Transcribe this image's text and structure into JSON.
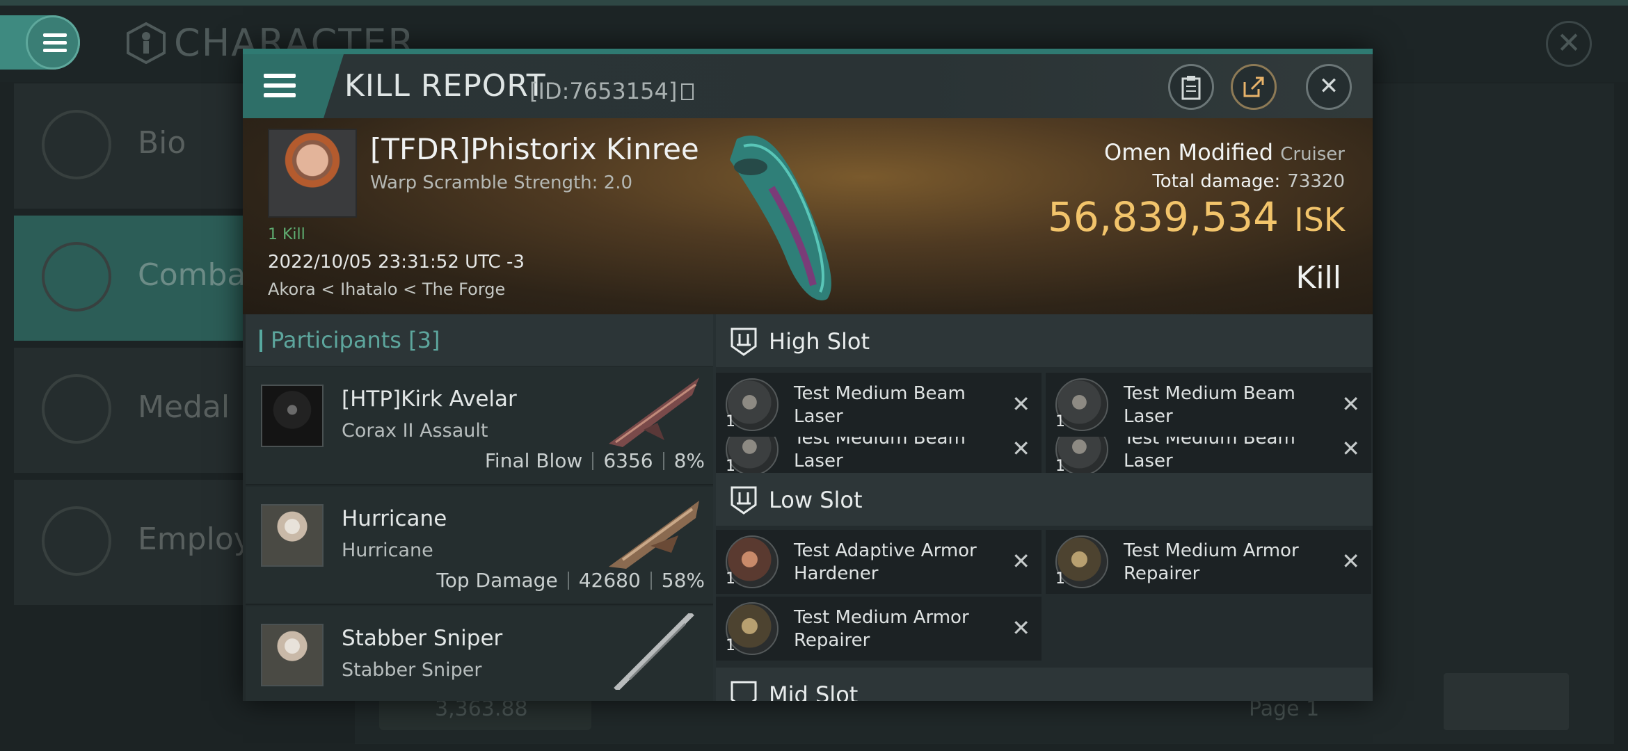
{
  "background": {
    "title": "CHARACTER",
    "sidebar": [
      {
        "label": "Bio",
        "icon": "list-icon"
      },
      {
        "label": "Combat",
        "icon": "crossed-swords-icon"
      },
      {
        "label": "Medal",
        "icon": "star-hexagon-icon"
      },
      {
        "label": "Employ",
        "icon": "star-circle-icon"
      }
    ],
    "amount": "3,363.88",
    "page": "Page 1"
  },
  "modal": {
    "title": "KILL REPORT",
    "id_label": "[ID:7653154]",
    "victim": {
      "name": "[TFDR]Phistorix Kinree",
      "warp_scramble": "Warp Scramble Strength: 2.0",
      "kills": "1 Kill",
      "time": "2022/10/05 23:31:52 UTC -3",
      "location": "Akora < Ihatalo < The Forge",
      "ship": "Omen Modified",
      "ship_class": "Cruiser",
      "total_damage_label": "Total damage:",
      "total_damage": "73320",
      "isk_value": "56,839,534",
      "isk_unit": "ISK",
      "result": "Kill"
    },
    "participants": {
      "heading": "Participants [3]",
      "rows": [
        {
          "name": "[HTP]Kirk Avelar",
          "ship": "Corax II Assault",
          "role": "Final Blow",
          "damage": "6356",
          "percent": "8%"
        },
        {
          "name": "Hurricane",
          "ship": "Hurricane",
          "role": "Top Damage",
          "damage": "42680",
          "percent": "58%"
        },
        {
          "name": "Stabber Sniper",
          "ship": "Stabber Sniper",
          "role": "",
          "damage": "",
          "percent": ""
        }
      ]
    },
    "fitting": {
      "high_slot": {
        "label": "High Slot",
        "modules": [
          {
            "name": "Test Medium Beam Laser",
            "qty": "1"
          },
          {
            "name": "Test Medium Beam Laser",
            "qty": "1"
          },
          {
            "name": "Test Medium Beam Laser",
            "qty": "1"
          },
          {
            "name": "Test Medium Beam Laser",
            "qty": "1"
          }
        ]
      },
      "low_slot": {
        "label": "Low Slot",
        "modules": [
          {
            "name": "Test Adaptive Armor Hardener",
            "qty": "1"
          },
          {
            "name": "Test Medium Armor Repairer",
            "qty": "1"
          },
          {
            "name": "Test Medium Armor Repairer",
            "qty": "1"
          }
        ]
      },
      "mid_slot_label": "Mid Slot"
    }
  },
  "colors": {
    "accent": "#3e8a80",
    "isk": "#f2c46b",
    "kills": "#5fae72"
  }
}
